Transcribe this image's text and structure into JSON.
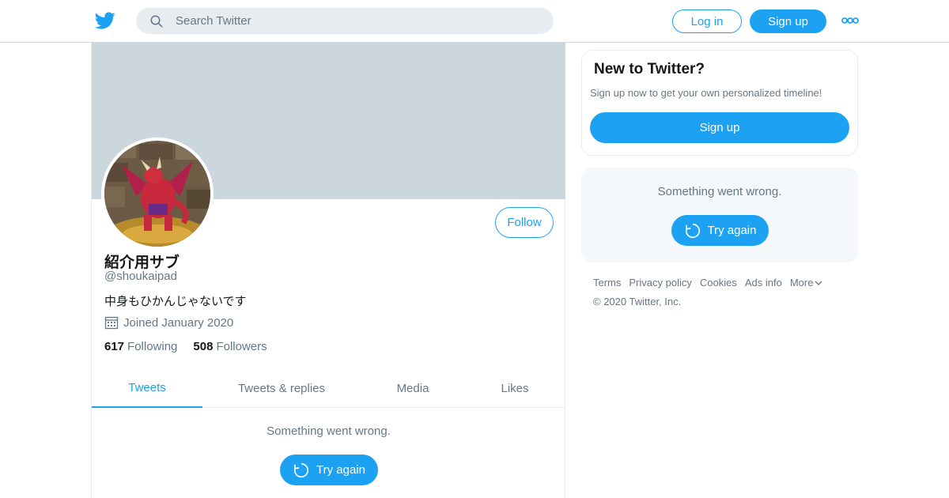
{
  "header": {
    "search_placeholder": "Search Twitter",
    "login_label": "Log in",
    "signup_label": "Sign up"
  },
  "profile": {
    "name": "紹介用サブ",
    "handle": "@shoukaipad",
    "bio": "中身もひかんじゃないです",
    "joined": "Joined January 2020",
    "following_count": "617",
    "following_label": "Following",
    "followers_count": "508",
    "followers_label": "Followers",
    "follow_label": "Follow"
  },
  "tabs": [
    {
      "label": "Tweets",
      "active": true
    },
    {
      "label": "Tweets & replies",
      "active": false
    },
    {
      "label": "Media",
      "active": false
    },
    {
      "label": "Likes",
      "active": false
    }
  ],
  "timeline": {
    "error_text": "Something went wrong.",
    "try_again_label": "Try again"
  },
  "sidebar": {
    "new_title": "New to Twitter?",
    "new_sub": "Sign up now to get your own personalized timeline!",
    "signup_label": "Sign up",
    "error_text": "Something went wrong.",
    "try_again_label": "Try again"
  },
  "footer": {
    "links": [
      "Terms",
      "Privacy policy",
      "Cookies",
      "Ads info",
      "More"
    ],
    "copyright": "© 2020 Twitter, Inc."
  },
  "colors": {
    "accent": "#1da1f2",
    "banner": "#ccd6dd",
    "secondary_text": "#657786"
  },
  "icons": [
    "twitter-logo-icon",
    "search-icon",
    "more-dots-icon",
    "calendar-icon",
    "refresh-icon",
    "chevron-down-icon"
  ]
}
